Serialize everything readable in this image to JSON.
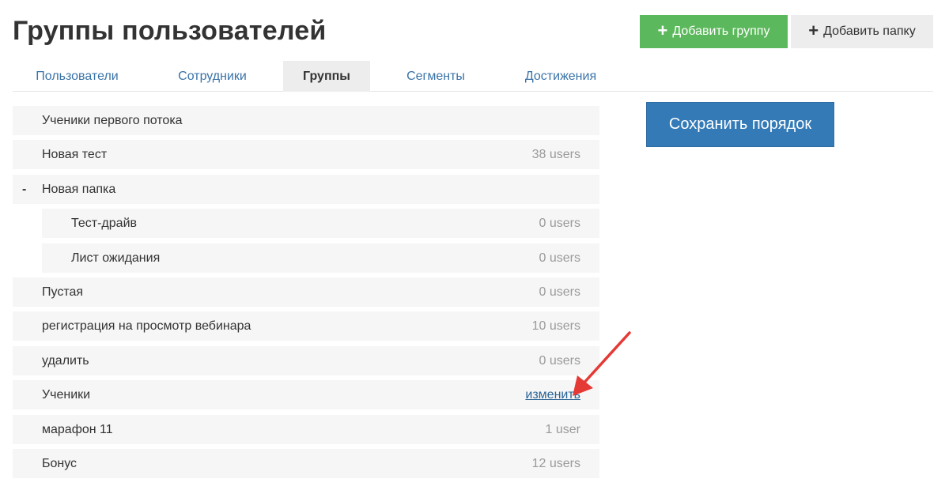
{
  "header": {
    "title": "Группы пользователей",
    "add_group_label": "Добавить группу",
    "add_folder_label": "Добавить папку"
  },
  "tabs": [
    {
      "label": "Пользователи",
      "active": false
    },
    {
      "label": "Сотрудники",
      "active": false
    },
    {
      "label": "Группы",
      "active": true
    },
    {
      "label": "Сегменты",
      "active": false
    },
    {
      "label": "Достижения",
      "active": false
    }
  ],
  "save_order_label": "Сохранить порядок",
  "groups": [
    {
      "name": "Ученики первого потока",
      "count": ""
    },
    {
      "name": "Новая тест",
      "count": "38 users"
    },
    {
      "name": "Новая папка",
      "count": "",
      "toggle": "-"
    },
    {
      "name": "Тест-драйв",
      "count": "0 users"
    },
    {
      "name": "Лист ожидания",
      "count": "0 users"
    },
    {
      "name": "Пустая",
      "count": "0 users"
    },
    {
      "name": "регистрация на просмотр вебинара",
      "count": "10 users"
    },
    {
      "name": "удалить",
      "count": "0 users"
    },
    {
      "name": "Ученики",
      "edit_label": "изменить"
    },
    {
      "name": "марафон 11",
      "count": "1 user"
    },
    {
      "name": "Бонус",
      "count": "12 users"
    }
  ],
  "colors": {
    "add_group_bg": "#5cb85c",
    "save_order_bg": "#337ab7",
    "tab_link": "#3a73a8",
    "annotation_arrow": "#e53935"
  },
  "icons": {
    "plus": "+",
    "annotation": "red-arrow-icon"
  }
}
